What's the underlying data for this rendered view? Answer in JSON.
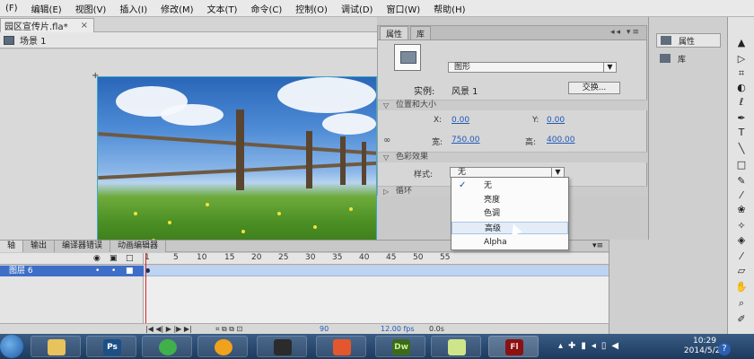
{
  "menu": [
    "(F)",
    "编辑(E)",
    "视图(V)",
    "插入(I)",
    "修改(M)",
    "文本(T)",
    "命令(C)",
    "控制(O)",
    "调试(D)",
    "窗口(W)",
    "帮助(H)"
  ],
  "document": {
    "tab_title": "园区宣传片.fla*",
    "close_label": "×"
  },
  "scene": {
    "label": "场景 1"
  },
  "properties": {
    "tabs": [
      "属性",
      "库"
    ],
    "symbol_type": "图形",
    "instance_label": "实例:",
    "instance_name": "风景 1",
    "swap_button": "交换...",
    "pos_size_header": "位置和大小",
    "x_label": "X:",
    "x_value": "0.00",
    "y_label": "Y:",
    "y_value": "0.00",
    "w_label": "宽:",
    "w_value": "750.00",
    "h_label": "高:",
    "h_value": "400.00",
    "color_effect_header": "色彩效果",
    "style_label": "样式:",
    "style_value": "无",
    "loop_header": "循环"
  },
  "dropdown": {
    "options": [
      "无",
      "亮度",
      "色调",
      "高级",
      "Alpha"
    ],
    "checked_index": 0,
    "hover_index": 3,
    "check_mark": "✓"
  },
  "right_panel": {
    "buttons": [
      "属性",
      "库"
    ]
  },
  "timeline": {
    "tabs": [
      "轴",
      "输出",
      "编译器错误",
      "动画编辑器"
    ],
    "ruler": [
      "1",
      "5",
      "10",
      "15",
      "20",
      "25",
      "30",
      "35",
      "40",
      "45",
      "50",
      "55"
    ],
    "layer_name": "图层 6",
    "status": {
      "frame": "1",
      "fps": "12.00 fps",
      "time": "0.0s",
      "extra": "90"
    }
  },
  "taskbar": {
    "apps": [
      {
        "name": "file-explorer",
        "text": ""
      },
      {
        "name": "photoshop",
        "text": "Ps"
      },
      {
        "name": "browser",
        "text": ""
      },
      {
        "name": "media",
        "text": ""
      },
      {
        "name": "recorder",
        "text": ""
      },
      {
        "name": "office",
        "text": ""
      },
      {
        "name": "dreamweaver",
        "text": "Dw"
      },
      {
        "name": "notes",
        "text": ""
      },
      {
        "name": "flash",
        "text": "Fl"
      }
    ],
    "time": "10:29",
    "date": "2014/5/20",
    "help": "?"
  }
}
